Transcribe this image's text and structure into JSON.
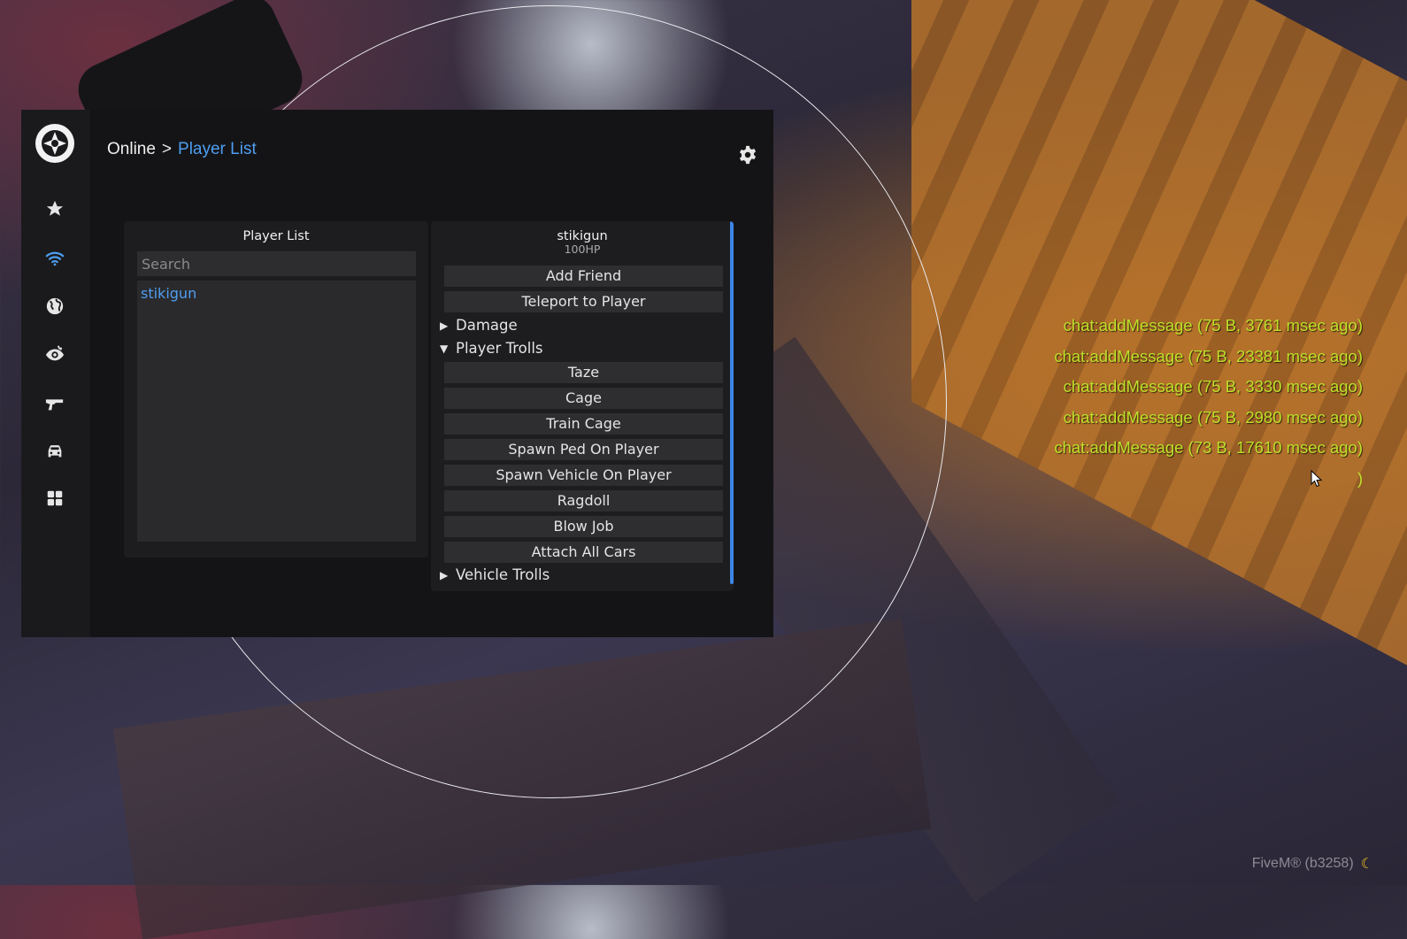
{
  "breadcrumb": {
    "parent": "Online",
    "separator": ">",
    "current": "Player List"
  },
  "sidebar": {
    "items": [
      {
        "id": "favorites",
        "icon": "star-icon"
      },
      {
        "id": "online",
        "icon": "wifi-icon",
        "active": true
      },
      {
        "id": "world",
        "icon": "globe-icon"
      },
      {
        "id": "visual",
        "icon": "eye-icon"
      },
      {
        "id": "weapons",
        "icon": "gun-icon"
      },
      {
        "id": "vehicles",
        "icon": "car-icon"
      },
      {
        "id": "misc",
        "icon": "grid-icon"
      }
    ]
  },
  "player_list": {
    "title": "Player List",
    "search_placeholder": "Search",
    "players": [
      "stikigun"
    ]
  },
  "player_detail": {
    "name": "stikigun",
    "health": "100HP",
    "actions": [
      "Add Friend",
      "Teleport to Player"
    ],
    "sections": [
      {
        "label": "Damage",
        "expanded": false
      },
      {
        "label": "Player Trolls",
        "expanded": true,
        "items": [
          "Taze",
          "Cage",
          "Train Cage",
          "Spawn Ped On Player",
          "Spawn Vehicle On Player",
          "Ragdoll",
          "Blow Job",
          "Attach All Cars"
        ]
      },
      {
        "label": "Vehicle Trolls",
        "expanded": false
      }
    ]
  },
  "chat_log": [
    "chat:addMessage (75 B, 3761 msec ago)",
    "chat:addMessage (75 B, 23381 msec ago)",
    "chat:addMessage (75 B, 3330 msec ago)",
    "chat:addMessage (75 B, 2980 msec ago)",
    "chat:addMessage (73 B, 17610 msec ago)"
  ],
  "chat_tail": ")",
  "footer": {
    "text": "FiveM® (b3258)",
    "icon": "moon-icon"
  },
  "colors": {
    "accent": "#4e9ef0",
    "chat": "#bfe02a",
    "panel": "#1d1d20"
  }
}
